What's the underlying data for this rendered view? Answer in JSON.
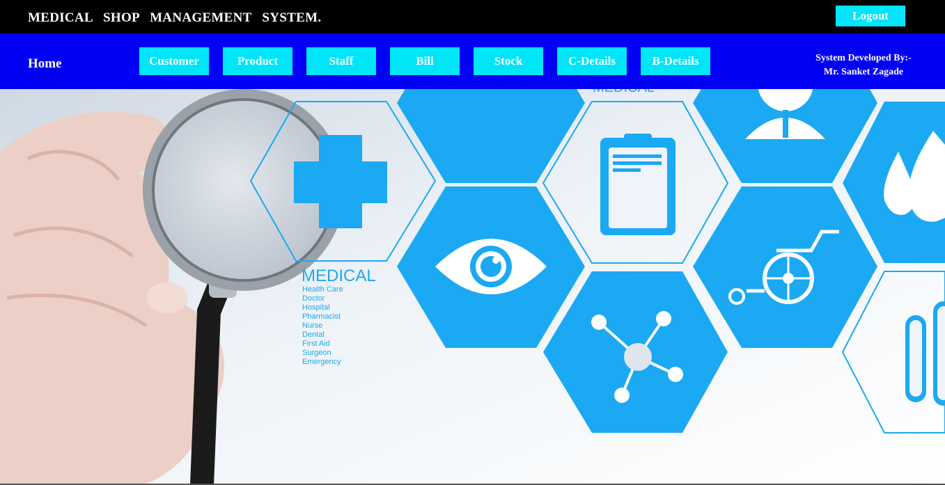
{
  "header": {
    "title": "MEDICAL   SHOP   MANAGEMENT   SYSTEM.",
    "logout_label": "Logout"
  },
  "nav": {
    "home_label": "Home",
    "buttons": [
      "Customer",
      "Product",
      "Staff",
      "Bill",
      "Stock",
      "C-Details",
      "B-Details"
    ],
    "developer_line1": "System Developed By:-",
    "developer_line2": "Mr. Sanket Zagade"
  },
  "hero": {
    "medical_top_label": "MEDICAL",
    "medical_label": "MEDICAL",
    "medical_terms": [
      "Health Care",
      "Doctor",
      "Hospital",
      "Pharmacist",
      "Nurse",
      "Dental",
      "First Aid",
      "Surgeon",
      "Emergency"
    ]
  },
  "colors": {
    "topbar": "#000000",
    "navbar": "#0000f5",
    "button": "#00e5f7",
    "hex_blue": "#1aa9f2"
  }
}
